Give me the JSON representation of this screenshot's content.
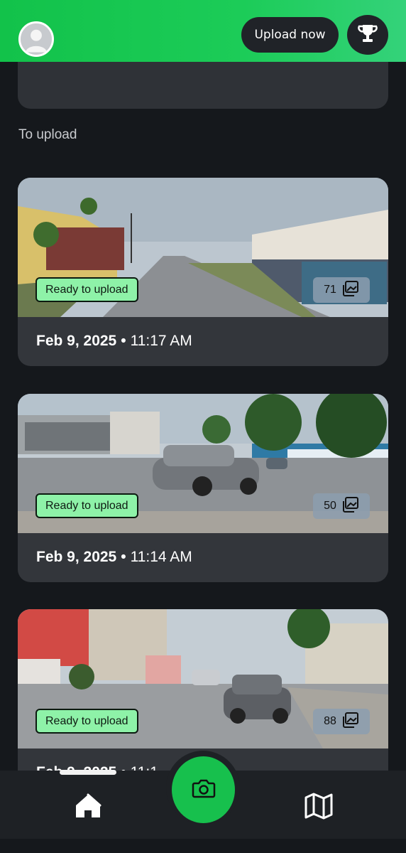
{
  "header": {
    "upload_label": "Upload now",
    "avatar_icon": "user-avatar-icon",
    "trophy_icon": "trophy-icon",
    "brand_green": "#17c04d"
  },
  "section": {
    "title": "To upload"
  },
  "cards": [
    {
      "status": "Ready to upload",
      "photo_count": "71",
      "date": "Feb 9, 2025",
      "time": "11:17 AM"
    },
    {
      "status": "Ready to upload",
      "photo_count": "50",
      "date": "Feb 9, 2025",
      "time": "11:14 AM"
    },
    {
      "status": "Ready to upload",
      "photo_count": "88",
      "date": "Feb 9, 2025",
      "time": "11:1"
    }
  ],
  "nav": {
    "home_icon": "home-icon",
    "camera_icon": "camera-icon",
    "map_icon": "map-icon"
  }
}
